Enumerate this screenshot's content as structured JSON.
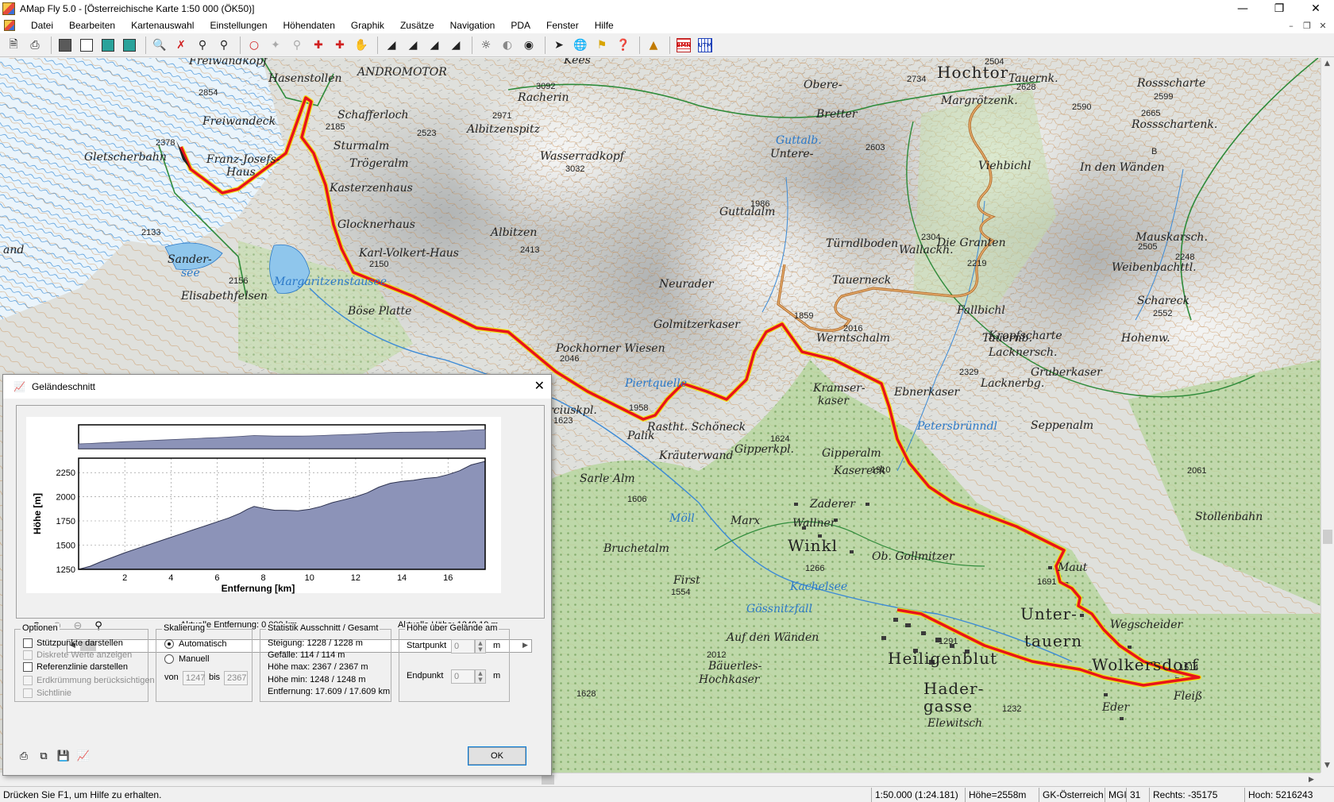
{
  "window": {
    "title": "AMap Fly 5.0 - [Österreichische Karte 1:50 000 (ÖK50)]"
  },
  "menu": [
    "Datei",
    "Bearbeiten",
    "Kartenauswahl",
    "Einstellungen",
    "Höhendaten",
    "Graphik",
    "Zusätze",
    "Navigation",
    "PDA",
    "Fenster",
    "Hilfe"
  ],
  "toolbar": {
    "icons": [
      "new-file-icon",
      "print-icon",
      "copy-map-icon",
      "copy-window-icon",
      "map-overview-icon",
      "map-detail-icon",
      "zoom-in-icon",
      "zoom-cancel-icon",
      "zoom-out-icon",
      "zoom-fit-icon",
      "circle-icon",
      "disabled-tool-icon",
      "pin-tool-icon",
      "measure-tool-icon",
      "edit-route-icon",
      "hand-pan-icon",
      "triangle-icon",
      "triangle-icon",
      "triangle-icon",
      "triangle-icon",
      "sun-icon",
      "shade-icon",
      "dot-icon",
      "arrow-icon",
      "globe-icon",
      "flag-icon",
      "help-cursor-icon",
      "relief-icon"
    ],
    "bmn_label": "BMN",
    "utm_label": "UTM"
  },
  "map": {
    "route_color": "#e8141a",
    "places": [
      {
        "text": "Hochtor",
        "big": true
      },
      {
        "text": "Freiwandkopf"
      },
      {
        "text": "2854"
      },
      {
        "text": "Freiwandeck"
      },
      {
        "text": "Gletscherbahn"
      },
      {
        "text": "Franz-Josefs-"
      },
      {
        "text": "Haus"
      },
      {
        "text": "Schafferloch"
      },
      {
        "text": "2185"
      },
      {
        "text": "Sturmalm"
      },
      {
        "text": "Trögeralm"
      },
      {
        "text": "Kasterzenhaus"
      },
      {
        "text": "Glocknerhaus"
      },
      {
        "text": "Karl-Volkert-Haus"
      },
      {
        "text": "2150"
      },
      {
        "text": "Sander-"
      },
      {
        "text": "see",
        "water": true
      },
      {
        "text": "Margaritzenstausee",
        "water": true
      },
      {
        "text": "2156"
      },
      {
        "text": "Elisabethfelsen"
      },
      {
        "text": "Böse Platte"
      },
      {
        "text": "2133"
      },
      {
        "text": "3092"
      },
      {
        "text": "Racherin"
      },
      {
        "text": "2971"
      },
      {
        "text": "Albitzenspitz"
      },
      {
        "text": "2523"
      },
      {
        "text": "Wasserradkopf"
      },
      {
        "text": "3032"
      },
      {
        "text": "Albitzen"
      },
      {
        "text": "2413"
      },
      {
        "text": "Pockhorner Wiesen"
      },
      {
        "text": "2046"
      },
      {
        "text": "Piertquelle",
        "water": true
      },
      {
        "text": "1958"
      },
      {
        "text": "Rastht. Schöneck"
      },
      {
        "text": "Palik"
      },
      {
        "text": "Kräuterwand"
      },
      {
        "text": "Neurader"
      },
      {
        "text": "Golmitzerkaser"
      },
      {
        "text": "Guttalalm"
      },
      {
        "text": "1986"
      },
      {
        "text": "Obere-"
      },
      {
        "text": "Bretter"
      },
      {
        "text": "Untere-"
      },
      {
        "text": "2603"
      },
      {
        "text": "Tauerneck"
      },
      {
        "text": "2016"
      },
      {
        "text": "Werntschalm"
      },
      {
        "text": "Türndlboden"
      },
      {
        "text": "Wallackh."
      },
      {
        "text": "2304"
      },
      {
        "text": "2219"
      },
      {
        "text": "Margrötzenk."
      },
      {
        "text": "Viehbichl"
      },
      {
        "text": "Fallbichl"
      },
      {
        "text": "Kropfscharte"
      },
      {
        "text": "Lacknersch."
      },
      {
        "text": "Lacknerbg."
      },
      {
        "text": "2329"
      },
      {
        "text": "Gruberkaser"
      },
      {
        "text": "Ebnerkaser"
      },
      {
        "text": "Kramser-"
      },
      {
        "text": "kaser"
      },
      {
        "text": "Petersbrünndl",
        "water": true
      },
      {
        "text": "Seppenalm"
      },
      {
        "text": "Rossscharte"
      },
      {
        "text": "2599"
      },
      {
        "text": "Rossschartenk."
      },
      {
        "text": "2665"
      },
      {
        "text": "Mauskarsch."
      },
      {
        "text": "2505"
      },
      {
        "text": "Weibenbachttl."
      },
      {
        "text": "2248"
      },
      {
        "text": "Schareck"
      },
      {
        "text": "2552"
      },
      {
        "text": "In den Wänden"
      },
      {
        "text": "Tauernk."
      },
      {
        "text": "2628"
      },
      {
        "text": "2504"
      },
      {
        "text": "2734"
      },
      {
        "text": "2590"
      },
      {
        "text": "Gipperkpl."
      },
      {
        "text": "1624"
      },
      {
        "text": "Gipperalm"
      },
      {
        "text": "Kasereck"
      },
      {
        "text": "1910"
      },
      {
        "text": "Zaderer"
      },
      {
        "text": "Wallner"
      },
      {
        "text": "Winkl",
        "big": true
      },
      {
        "text": "Ob. Gollmitzer"
      },
      {
        "text": "1266"
      },
      {
        "text": "Maut"
      },
      {
        "text": "1691"
      },
      {
        "text": "Unter-"
      },
      {
        "text": "tauern"
      },
      {
        "text": "Wegscheider"
      },
      {
        "text": "Stollenbahn"
      },
      {
        "text": "2061"
      },
      {
        "text": "Heiligenblut",
        "big": true
      },
      {
        "text": "1291"
      },
      {
        "text": "Wolkersdorf",
        "big": true
      },
      {
        "text": "1514"
      },
      {
        "text": "Hader-"
      },
      {
        "text": "gasse"
      },
      {
        "text": "Eder"
      },
      {
        "text": "Fleiß"
      },
      {
        "text": "Elewitsch"
      },
      {
        "text": "1232"
      },
      {
        "text": "Bruchetalm"
      },
      {
        "text": "First"
      },
      {
        "text": "1554"
      },
      {
        "text": "Kachelsee",
        "water": true
      },
      {
        "text": "Gössnitzfall",
        "water": true
      },
      {
        "text": "Auf den Wänden"
      },
      {
        "text": "2012"
      },
      {
        "text": "Bäuerles-"
      },
      {
        "text": "Hochkaser"
      },
      {
        "text": "1628"
      },
      {
        "text": "Möll",
        "water": true
      },
      {
        "text": "Marx"
      },
      {
        "text": "1606"
      },
      {
        "text": "Die Granten"
      },
      {
        "text": "Tauernb."
      },
      {
        "text": "Sarle Alm"
      },
      {
        "text": "Zirciuskpl."
      },
      {
        "text": "1623"
      },
      {
        "text": "Guttalb.",
        "water": true
      },
      {
        "text": "2378"
      },
      {
        "text": "and"
      },
      {
        "text": "Hohenw."
      },
      {
        "text": "1859"
      },
      {
        "text": "Kees"
      },
      {
        "text": "Hasenstollen"
      },
      {
        "text": "ANDROMOTOR"
      },
      {
        "text": "B"
      }
    ]
  },
  "dialog": {
    "title": "Geländeschnitt",
    "current_distance": "Aktuelle Entfernung: 0.000 km",
    "current_height": "Aktuelle Höhe: 1248.19 m",
    "options": {
      "legend": "Optionen",
      "items": [
        {
          "label": "Stützpunkte darstellen",
          "enabled": true,
          "checked": false
        },
        {
          "label": "Diskrete Werte anzeigen",
          "enabled": false,
          "checked": false
        },
        {
          "label": "Referenzlinie darstellen",
          "enabled": true,
          "checked": false
        },
        {
          "label": "Erdkrümmung berücksichtigen",
          "enabled": false,
          "checked": false
        },
        {
          "label": "Sichtlinie",
          "enabled": false,
          "checked": false
        }
      ]
    },
    "scaling": {
      "legend": "Skalierung",
      "auto": "Automatisch",
      "manual": "Manuell",
      "selected": "Automatisch",
      "from_label": "von",
      "from_value": "1247",
      "to_label": "bis",
      "to_value": "2367"
    },
    "stats": {
      "legend": "Statistik   Ausschnitt / Gesamt",
      "lines": [
        "Steigung: 1228 / 1228 m",
        "Gefälle: 114 / 114 m",
        "Höhe max: 2367 / 2367 m",
        "Höhe min: 1248 / 1248 m",
        "Entfernung: 17.609 / 17.609 km"
      ]
    },
    "height_above": {
      "legend": "Höhe über Gelände am",
      "start_label": "Startpunkt",
      "start_value": "0",
      "end_label": "Endpunkt",
      "end_value": "0",
      "unit": "m"
    },
    "ok_label": "OK"
  },
  "chart_data": {
    "type": "area",
    "title": "",
    "xlabel": "Entfernung [km]",
    "ylabel": "Höhe [m]",
    "xlim": [
      0,
      17.609
    ],
    "ylim": [
      1248,
      2367
    ],
    "xticks": [
      2,
      4,
      6,
      8,
      10,
      12,
      14,
      16
    ],
    "yticks": [
      1250,
      1500,
      1750,
      2000,
      2250
    ],
    "fill_color": "#8c93b8",
    "series": [
      {
        "x": [
          0,
          0.5,
          1,
          1.5,
          2,
          2.5,
          3,
          3.5,
          4,
          4.5,
          5,
          5.5,
          6,
          6.5,
          7,
          7.3,
          7.6,
          8,
          8.5,
          9,
          9.5,
          10,
          10.5,
          11,
          11.5,
          12,
          12.5,
          13,
          13.5,
          14,
          14.5,
          15,
          15.5,
          16,
          16.5,
          17,
          17.609
        ],
        "values": [
          1248,
          1280,
          1330,
          1375,
          1420,
          1460,
          1500,
          1540,
          1580,
          1620,
          1660,
          1700,
          1740,
          1780,
          1830,
          1870,
          1900,
          1880,
          1860,
          1860,
          1855,
          1870,
          1900,
          1940,
          1970,
          2000,
          2040,
          2100,
          2140,
          2160,
          2170,
          2190,
          2200,
          2230,
          2270,
          2330,
          2367
        ]
      }
    ]
  },
  "status": {
    "hint": "Drücken Sie F1, um Hilfe zu erhalten.",
    "scale": "1:50.000  (1:24.181)",
    "height": "Höhe=2558m",
    "coord_system": "GK-Österreich",
    "mgi": "MGI",
    "zone": "31",
    "easting": "Rechts:  -35175",
    "northing": "Hoch: 5216243"
  }
}
